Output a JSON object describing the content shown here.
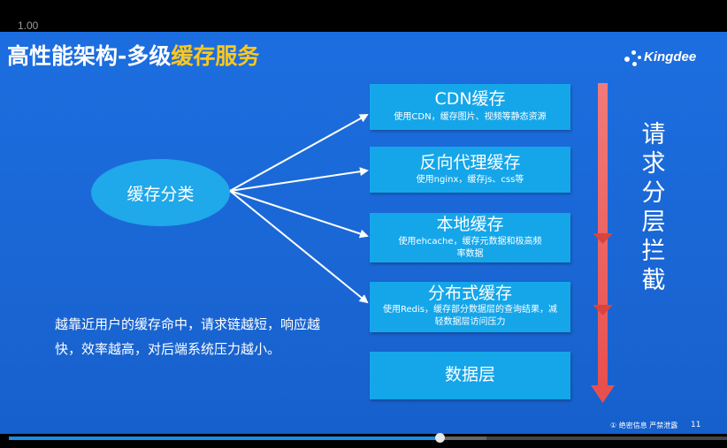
{
  "player": {
    "speed": "1.00",
    "progress": 0.6,
    "buffered": 0.665
  },
  "slide": {
    "title_main": "高性能架构-多级",
    "title_highlight": "缓存服务",
    "logo_text": "Kingdee",
    "center_label": "缓存分类",
    "layers": [
      {
        "title": "CDN缓存",
        "desc": "使用CDN，缓存图片、视频等静态资源"
      },
      {
        "title": "反向代理缓存",
        "desc": "使用nginx，缓存js、css等"
      },
      {
        "title": "本地缓存",
        "desc": "使用ehcache，缓存元数据和极高频率数据"
      },
      {
        "title": "分布式缓存",
        "desc": "使用Redis，缓存部分数据层的查询结果，减轻数据层访问压力"
      },
      {
        "title": "数据层",
        "desc": ""
      }
    ],
    "vertical_label": "请求分层拦截",
    "note": "越靠近用户的缓存命中，请求链越短，响应越快，效率越高，对后端系统压力越小。",
    "footer": "① 绝密信息 严禁泄露",
    "page_number": "11"
  },
  "colors": {
    "background": "#1a66d4",
    "box": "#15a6ea",
    "ellipse": "#1fa8ea",
    "highlight": "#ffc71c",
    "arrow": "#e8504f"
  }
}
